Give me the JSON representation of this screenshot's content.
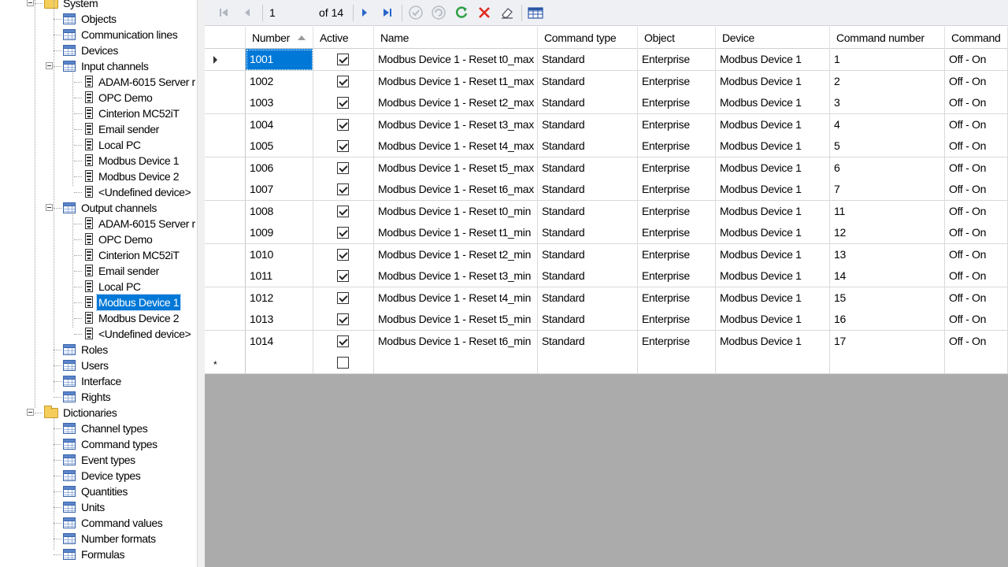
{
  "tree": {
    "items": [
      {
        "label": "System",
        "icon": "folder-icon"
      },
      {
        "label": "Objects",
        "icon": "table-icon"
      },
      {
        "label": "Communication lines",
        "icon": "table-icon"
      },
      {
        "label": "Devices",
        "icon": "table-icon"
      },
      {
        "label": "Input channels",
        "icon": "table-icon"
      },
      {
        "label": "ADAM-6015 Server r",
        "icon": "device-icon"
      },
      {
        "label": "OPC Demo",
        "icon": "device-icon"
      },
      {
        "label": "Cinterion MC52iT",
        "icon": "device-icon"
      },
      {
        "label": "Email sender",
        "icon": "device-icon"
      },
      {
        "label": "Local PC",
        "icon": "device-icon"
      },
      {
        "label": "Modbus Device 1",
        "icon": "device-icon"
      },
      {
        "label": "Modbus Device 2",
        "icon": "device-icon"
      },
      {
        "label": "<Undefined device>",
        "icon": "device-icon"
      },
      {
        "label": "Output channels",
        "icon": "table-icon"
      },
      {
        "label": "ADAM-6015 Server r",
        "icon": "device-icon"
      },
      {
        "label": "OPC Demo",
        "icon": "device-icon"
      },
      {
        "label": "Cinterion MC52iT",
        "icon": "device-icon"
      },
      {
        "label": "Email sender",
        "icon": "device-icon"
      },
      {
        "label": "Local PC",
        "icon": "device-icon"
      },
      {
        "label": "Modbus Device 1",
        "icon": "device-icon",
        "selected": true
      },
      {
        "label": "Modbus Device 2",
        "icon": "device-icon"
      },
      {
        "label": "<Undefined device>",
        "icon": "device-icon"
      },
      {
        "label": "Roles",
        "icon": "table-icon"
      },
      {
        "label": "Users",
        "icon": "table-icon"
      },
      {
        "label": "Interface",
        "icon": "table-icon"
      },
      {
        "label": "Rights",
        "icon": "table-icon"
      },
      {
        "label": "Dictionaries",
        "icon": "folder-icon"
      },
      {
        "label": "Channel types",
        "icon": "table-icon"
      },
      {
        "label": "Command types",
        "icon": "table-icon"
      },
      {
        "label": "Event types",
        "icon": "table-icon"
      },
      {
        "label": "Device types",
        "icon": "table-icon"
      },
      {
        "label": "Quantities",
        "icon": "table-icon"
      },
      {
        "label": "Units",
        "icon": "table-icon"
      },
      {
        "label": "Command values",
        "icon": "table-icon"
      },
      {
        "label": "Number formats",
        "icon": "table-icon"
      },
      {
        "label": "Formulas",
        "icon": "table-icon"
      }
    ]
  },
  "toolbar": {
    "position_value": "1",
    "of_label": "of 14",
    "icons": [
      "first-record-icon",
      "previous-record-icon",
      "next-record-icon",
      "last-record-icon",
      "save-icon",
      "cancel-edit-icon",
      "refresh-icon",
      "delete-icon",
      "clear-icon",
      "table-settings-icon"
    ]
  },
  "grid": {
    "columns": [
      "Number",
      "Active",
      "Name",
      "Command type",
      "Object",
      "Device",
      "Command number",
      "Command"
    ],
    "rows": [
      {
        "number": "1001",
        "active": true,
        "name": "Modbus Device 1 - Reset t0_max",
        "command_type": "Standard",
        "object": "Enterprise",
        "device": "Modbus Device 1",
        "command_number": "1",
        "command": "Off - On"
      },
      {
        "number": "1002",
        "active": true,
        "name": "Modbus Device 1 - Reset t1_max",
        "command_type": "Standard",
        "object": "Enterprise",
        "device": "Modbus Device 1",
        "command_number": "2",
        "command": "Off - On"
      },
      {
        "number": "1003",
        "active": true,
        "name": "Modbus Device 1 - Reset t2_max",
        "command_type": "Standard",
        "object": "Enterprise",
        "device": "Modbus Device 1",
        "command_number": "3",
        "command": "Off - On"
      },
      {
        "number": "1004",
        "active": true,
        "name": "Modbus Device 1 - Reset t3_max",
        "command_type": "Standard",
        "object": "Enterprise",
        "device": "Modbus Device 1",
        "command_number": "4",
        "command": "Off - On"
      },
      {
        "number": "1005",
        "active": true,
        "name": "Modbus Device 1 - Reset t4_max",
        "command_type": "Standard",
        "object": "Enterprise",
        "device": "Modbus Device 1",
        "command_number": "5",
        "command": "Off - On"
      },
      {
        "number": "1006",
        "active": true,
        "name": "Modbus Device 1 - Reset t5_max",
        "command_type": "Standard",
        "object": "Enterprise",
        "device": "Modbus Device 1",
        "command_number": "6",
        "command": "Off - On"
      },
      {
        "number": "1007",
        "active": true,
        "name": "Modbus Device 1 - Reset t6_max",
        "command_type": "Standard",
        "object": "Enterprise",
        "device": "Modbus Device 1",
        "command_number": "7",
        "command": "Off - On"
      },
      {
        "number": "1008",
        "active": true,
        "name": "Modbus Device 1 - Reset t0_min",
        "command_type": "Standard",
        "object": "Enterprise",
        "device": "Modbus Device 1",
        "command_number": "11",
        "command": "Off - On"
      },
      {
        "number": "1009",
        "active": true,
        "name": "Modbus Device 1 - Reset t1_min",
        "command_type": "Standard",
        "object": "Enterprise",
        "device": "Modbus Device 1",
        "command_number": "12",
        "command": "Off - On"
      },
      {
        "number": "1010",
        "active": true,
        "name": "Modbus Device 1 - Reset t2_min",
        "command_type": "Standard",
        "object": "Enterprise",
        "device": "Modbus Device 1",
        "command_number": "13",
        "command": "Off - On"
      },
      {
        "number": "1011",
        "active": true,
        "name": "Modbus Device 1 - Reset t3_min",
        "command_type": "Standard",
        "object": "Enterprise",
        "device": "Modbus Device 1",
        "command_number": "14",
        "command": "Off - On"
      },
      {
        "number": "1012",
        "active": true,
        "name": "Modbus Device 1 - Reset t4_min",
        "command_type": "Standard",
        "object": "Enterprise",
        "device": "Modbus Device 1",
        "command_number": "15",
        "command": "Off - On"
      },
      {
        "number": "1013",
        "active": true,
        "name": "Modbus Device 1 - Reset t5_min",
        "command_type": "Standard",
        "object": "Enterprise",
        "device": "Modbus Device 1",
        "command_number": "16",
        "command": "Off - On"
      },
      {
        "number": "1014",
        "active": true,
        "name": "Modbus Device 1 - Reset t6_min",
        "command_type": "Standard",
        "object": "Enterprise",
        "device": "Modbus Device 1",
        "command_number": "17",
        "command": "Off - On"
      }
    ],
    "new_row_marker": "*"
  }
}
